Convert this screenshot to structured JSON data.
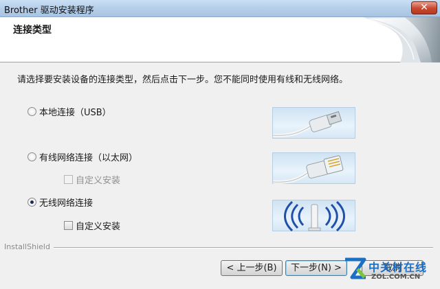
{
  "window": {
    "title": "Brother 驱动安装程序",
    "close_glyph": "✕"
  },
  "header": {
    "title": "连接类型"
  },
  "instruction": "请选择要安装设备的连接类型，然后点击下一步。您不能同时使用有线和无线网络。",
  "options": [
    {
      "label": "本地连接（USB）",
      "selected": false,
      "illustration": "usb-cable-icon"
    },
    {
      "label": "有线网络连接（以太网）",
      "selected": false,
      "illustration": "ethernet-cable-icon",
      "custom_install": {
        "label": "自定义安装",
        "enabled": false,
        "checked": false
      }
    },
    {
      "label": "无线网络连接",
      "selected": true,
      "illustration": "wireless-signal-icon",
      "custom_install": {
        "label": "自定义安装",
        "enabled": true,
        "checked": false
      }
    }
  ],
  "footer": {
    "installshield": "InstallShield"
  },
  "buttons": {
    "back": "< 上一步(B)",
    "next": "下一步(N) >",
    "cancel": "取消"
  },
  "watermark": {
    "brand": "中关村在线",
    "domain": "ZOL.COM.CN"
  },
  "colors": {
    "titlebar": "#b4cde8",
    "accent_blue": "#1b6fc4",
    "panel": "#f0f0f0"
  }
}
